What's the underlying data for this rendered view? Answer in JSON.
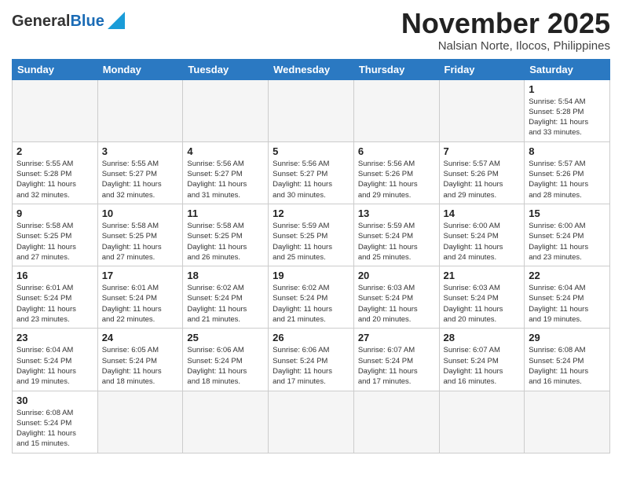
{
  "header": {
    "logo_general": "General",
    "logo_blue": "Blue",
    "month_title": "November 2025",
    "subtitle": "Nalsian Norte, Ilocos, Philippines"
  },
  "weekdays": [
    "Sunday",
    "Monday",
    "Tuesday",
    "Wednesday",
    "Thursday",
    "Friday",
    "Saturday"
  ],
  "weeks": [
    [
      {
        "day": "",
        "info": ""
      },
      {
        "day": "",
        "info": ""
      },
      {
        "day": "",
        "info": ""
      },
      {
        "day": "",
        "info": ""
      },
      {
        "day": "",
        "info": ""
      },
      {
        "day": "",
        "info": ""
      },
      {
        "day": "1",
        "info": "Sunrise: 5:54 AM\nSunset: 5:28 PM\nDaylight: 11 hours\nand 33 minutes."
      }
    ],
    [
      {
        "day": "2",
        "info": "Sunrise: 5:55 AM\nSunset: 5:28 PM\nDaylight: 11 hours\nand 32 minutes."
      },
      {
        "day": "3",
        "info": "Sunrise: 5:55 AM\nSunset: 5:27 PM\nDaylight: 11 hours\nand 32 minutes."
      },
      {
        "day": "4",
        "info": "Sunrise: 5:56 AM\nSunset: 5:27 PM\nDaylight: 11 hours\nand 31 minutes."
      },
      {
        "day": "5",
        "info": "Sunrise: 5:56 AM\nSunset: 5:27 PM\nDaylight: 11 hours\nand 30 minutes."
      },
      {
        "day": "6",
        "info": "Sunrise: 5:56 AM\nSunset: 5:26 PM\nDaylight: 11 hours\nand 29 minutes."
      },
      {
        "day": "7",
        "info": "Sunrise: 5:57 AM\nSunset: 5:26 PM\nDaylight: 11 hours\nand 29 minutes."
      },
      {
        "day": "8",
        "info": "Sunrise: 5:57 AM\nSunset: 5:26 PM\nDaylight: 11 hours\nand 28 minutes."
      }
    ],
    [
      {
        "day": "9",
        "info": "Sunrise: 5:58 AM\nSunset: 5:25 PM\nDaylight: 11 hours\nand 27 minutes."
      },
      {
        "day": "10",
        "info": "Sunrise: 5:58 AM\nSunset: 5:25 PM\nDaylight: 11 hours\nand 27 minutes."
      },
      {
        "day": "11",
        "info": "Sunrise: 5:58 AM\nSunset: 5:25 PM\nDaylight: 11 hours\nand 26 minutes."
      },
      {
        "day": "12",
        "info": "Sunrise: 5:59 AM\nSunset: 5:25 PM\nDaylight: 11 hours\nand 25 minutes."
      },
      {
        "day": "13",
        "info": "Sunrise: 5:59 AM\nSunset: 5:24 PM\nDaylight: 11 hours\nand 25 minutes."
      },
      {
        "day": "14",
        "info": "Sunrise: 6:00 AM\nSunset: 5:24 PM\nDaylight: 11 hours\nand 24 minutes."
      },
      {
        "day": "15",
        "info": "Sunrise: 6:00 AM\nSunset: 5:24 PM\nDaylight: 11 hours\nand 23 minutes."
      }
    ],
    [
      {
        "day": "16",
        "info": "Sunrise: 6:01 AM\nSunset: 5:24 PM\nDaylight: 11 hours\nand 23 minutes."
      },
      {
        "day": "17",
        "info": "Sunrise: 6:01 AM\nSunset: 5:24 PM\nDaylight: 11 hours\nand 22 minutes."
      },
      {
        "day": "18",
        "info": "Sunrise: 6:02 AM\nSunset: 5:24 PM\nDaylight: 11 hours\nand 21 minutes."
      },
      {
        "day": "19",
        "info": "Sunrise: 6:02 AM\nSunset: 5:24 PM\nDaylight: 11 hours\nand 21 minutes."
      },
      {
        "day": "20",
        "info": "Sunrise: 6:03 AM\nSunset: 5:24 PM\nDaylight: 11 hours\nand 20 minutes."
      },
      {
        "day": "21",
        "info": "Sunrise: 6:03 AM\nSunset: 5:24 PM\nDaylight: 11 hours\nand 20 minutes."
      },
      {
        "day": "22",
        "info": "Sunrise: 6:04 AM\nSunset: 5:24 PM\nDaylight: 11 hours\nand 19 minutes."
      }
    ],
    [
      {
        "day": "23",
        "info": "Sunrise: 6:04 AM\nSunset: 5:24 PM\nDaylight: 11 hours\nand 19 minutes."
      },
      {
        "day": "24",
        "info": "Sunrise: 6:05 AM\nSunset: 5:24 PM\nDaylight: 11 hours\nand 18 minutes."
      },
      {
        "day": "25",
        "info": "Sunrise: 6:06 AM\nSunset: 5:24 PM\nDaylight: 11 hours\nand 18 minutes."
      },
      {
        "day": "26",
        "info": "Sunrise: 6:06 AM\nSunset: 5:24 PM\nDaylight: 11 hours\nand 17 minutes."
      },
      {
        "day": "27",
        "info": "Sunrise: 6:07 AM\nSunset: 5:24 PM\nDaylight: 11 hours\nand 17 minutes."
      },
      {
        "day": "28",
        "info": "Sunrise: 6:07 AM\nSunset: 5:24 PM\nDaylight: 11 hours\nand 16 minutes."
      },
      {
        "day": "29",
        "info": "Sunrise: 6:08 AM\nSunset: 5:24 PM\nDaylight: 11 hours\nand 16 minutes."
      }
    ],
    [
      {
        "day": "30",
        "info": "Sunrise: 6:08 AM\nSunset: 5:24 PM\nDaylight: 11 hours\nand 15 minutes."
      },
      {
        "day": "",
        "info": ""
      },
      {
        "day": "",
        "info": ""
      },
      {
        "day": "",
        "info": ""
      },
      {
        "day": "",
        "info": ""
      },
      {
        "day": "",
        "info": ""
      },
      {
        "day": "",
        "info": ""
      }
    ]
  ]
}
